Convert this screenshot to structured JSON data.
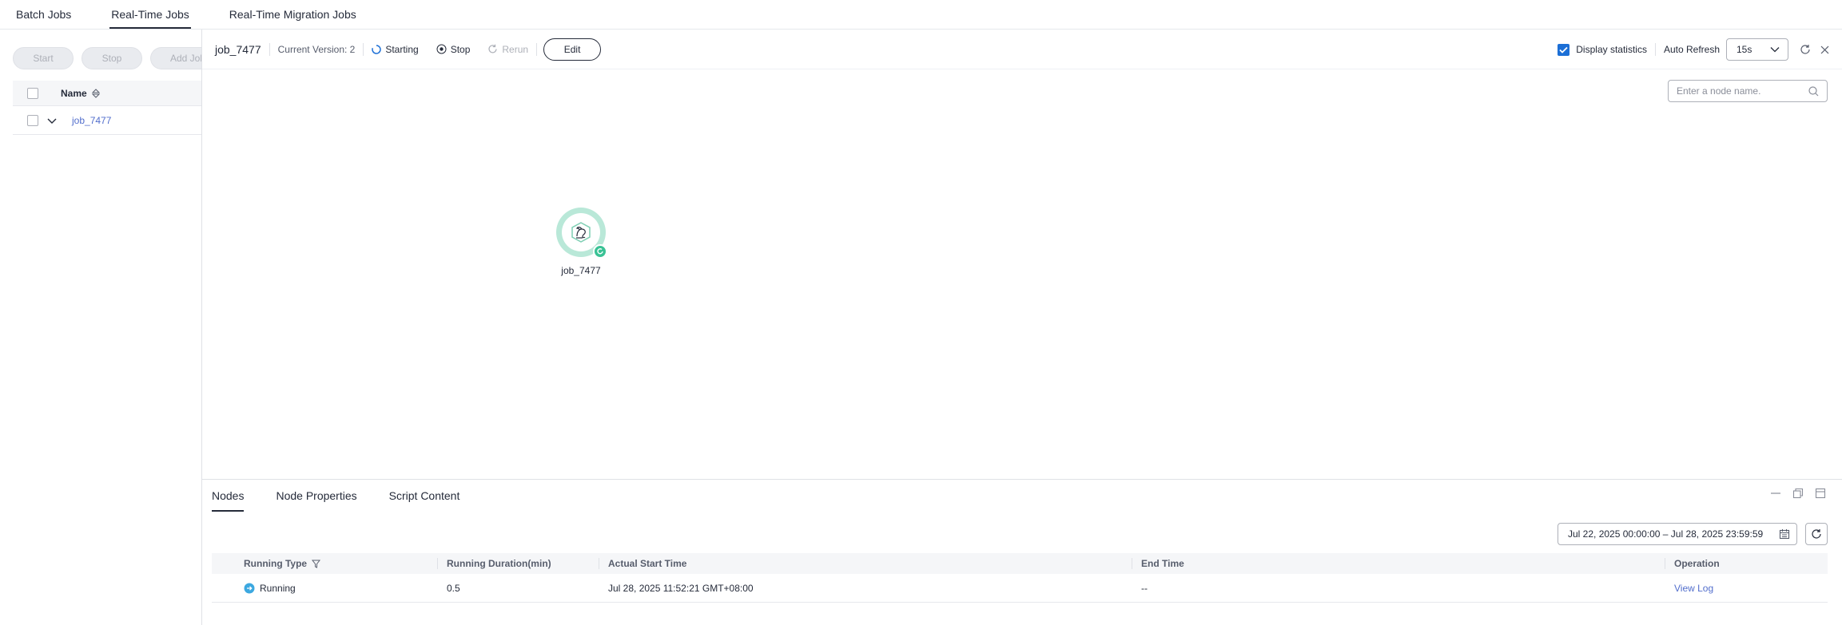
{
  "top_tabs": [
    {
      "label": "Batch Jobs",
      "active": false
    },
    {
      "label": "Real-Time Jobs",
      "active": true
    },
    {
      "label": "Real-Time Migration Jobs",
      "active": false
    }
  ],
  "left": {
    "toolbar": {
      "start": "Start",
      "stop": "Stop",
      "add_job": "Add Job"
    },
    "table": {
      "name_header": "Name",
      "rows": [
        {
          "name": "job_7477"
        }
      ]
    }
  },
  "detail": {
    "job_name": "job_7477",
    "version": "Current Version: 2",
    "status": "Starting",
    "stop": "Stop",
    "rerun": "Rerun",
    "edit": "Edit",
    "display_statistics": "Display statistics",
    "auto_refresh_label": "Auto Refresh",
    "auto_refresh_value": "15s",
    "node_search_placeholder": "Enter a node name.",
    "node": {
      "label": "job_7477"
    }
  },
  "bottom": {
    "tabs": [
      "Nodes",
      "Node Properties",
      "Script Content"
    ],
    "date_range": "Jul 22, 2025 00:00:00 – Jul 28, 2025 23:59:59",
    "columns": [
      "Running Type",
      "Running Duration(min)",
      "Actual Start Time",
      "End Time",
      "Operation"
    ],
    "rows": [
      {
        "running_type": "Running",
        "duration": "0.5",
        "start": "Jul 28, 2025 11:52:21 GMT+08:00",
        "end": "--",
        "operation": "View Log"
      }
    ]
  },
  "colors": {
    "accent": "#1c6fd6",
    "link": "#526ecc",
    "node_status": "#3ac295",
    "running_icon": "#3ca8e0"
  }
}
